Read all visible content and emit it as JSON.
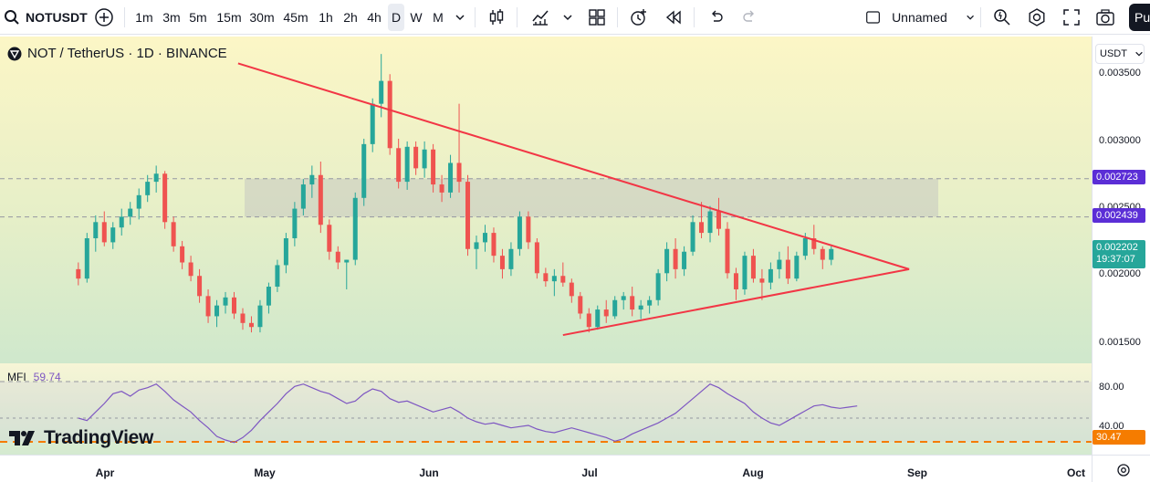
{
  "toolbar": {
    "symbol": "NOTUSDT",
    "intervals": [
      "1m",
      "3m",
      "5m",
      "15m",
      "30m",
      "45m",
      "1h",
      "2h",
      "4h",
      "D",
      "W",
      "M"
    ],
    "active_interval": "D",
    "layout_name": "Unnamed",
    "publish_label": "Pu"
  },
  "chart": {
    "title": "NOT / TetherUS · 1D · BINANCE",
    "unit": "USDT",
    "price_ticks": [
      "0.003500",
      "0.003000",
      "0.002000",
      "0.001500"
    ],
    "partial_tick": "0.002500",
    "tags": {
      "upper_zone": "0.002723",
      "lower_zone": "0.002439",
      "last_price": "0.002202",
      "countdown": "19:37:07"
    },
    "time_labels": [
      "Apr",
      "May",
      "Jun",
      "Jul",
      "Aug",
      "Sep",
      "Oct"
    ],
    "colors": {
      "up": "#26a69a",
      "down": "#ef5350",
      "trendline": "#f23645",
      "mfi_line": "#7e57c2",
      "tag_purple": "#5b2ed6",
      "tag_teal": "#26a69a",
      "tag_orange": "#f57c00"
    }
  },
  "mfi": {
    "label": "MFI",
    "value": "59.74",
    "ticks": [
      "80.00",
      "40.00"
    ],
    "level_tag": "30.47"
  },
  "logo": {
    "text": "TradingView"
  },
  "chart_data": {
    "type": "candlestick",
    "title": "NOT / TetherUS · 1D · BINANCE",
    "ylim": [
      0.00135,
      0.00378
    ],
    "zone": [
      0.002439,
      0.002723
    ],
    "trendlines": [
      {
        "from": [
          "2024-04-26",
          0.00358
        ],
        "to": [
          "2024-08-30",
          0.00205
        ]
      },
      {
        "from": [
          "2024-06-26",
          0.00156
        ],
        "to": [
          "2024-08-30",
          0.00205
        ]
      }
    ],
    "candles": [
      [
        0.00205,
        0.0021,
        0.00193,
        0.00198
      ],
      [
        0.00198,
        0.00232,
        0.00195,
        0.00228
      ],
      [
        0.00228,
        0.00245,
        0.00218,
        0.0024
      ],
      [
        0.0024,
        0.00248,
        0.00222,
        0.00225
      ],
      [
        0.00225,
        0.0024,
        0.0022,
        0.00236
      ],
      [
        0.00236,
        0.0025,
        0.0023,
        0.00244
      ],
      [
        0.00244,
        0.00255,
        0.00238,
        0.0025
      ],
      [
        0.0025,
        0.00265,
        0.00242,
        0.0026
      ],
      [
        0.0026,
        0.00275,
        0.00255,
        0.0027
      ],
      [
        0.0027,
        0.00282,
        0.00262,
        0.00276
      ],
      [
        0.00276,
        0.00278,
        0.00235,
        0.0024
      ],
      [
        0.0024,
        0.00244,
        0.00218,
        0.00222
      ],
      [
        0.00222,
        0.00226,
        0.00205,
        0.0021
      ],
      [
        0.0021,
        0.00215,
        0.00196,
        0.002
      ],
      [
        0.002,
        0.00205,
        0.0018,
        0.00185
      ],
      [
        0.00185,
        0.0019,
        0.00165,
        0.0017
      ],
      [
        0.0017,
        0.00182,
        0.00162,
        0.00178
      ],
      [
        0.00178,
        0.00188,
        0.00172,
        0.00184
      ],
      [
        0.00184,
        0.00188,
        0.00168,
        0.00172
      ],
      [
        0.00172,
        0.00176,
        0.0016,
        0.00165
      ],
      [
        0.00165,
        0.0017,
        0.00158,
        0.00162
      ],
      [
        0.00162,
        0.00182,
        0.00158,
        0.00178
      ],
      [
        0.00178,
        0.00195,
        0.00172,
        0.00192
      ],
      [
        0.00192,
        0.00212,
        0.00188,
        0.00208
      ],
      [
        0.00208,
        0.00232,
        0.00202,
        0.00228
      ],
      [
        0.00228,
        0.00255,
        0.00222,
        0.0025
      ],
      [
        0.0025,
        0.00272,
        0.00245,
        0.00268
      ],
      [
        0.00268,
        0.00282,
        0.00258,
        0.00275
      ],
      [
        0.00275,
        0.00285,
        0.00232,
        0.00238
      ],
      [
        0.00238,
        0.00242,
        0.00212,
        0.00218
      ],
      [
        0.00218,
        0.00222,
        0.00205,
        0.0021
      ],
      [
        0.0021,
        0.00212,
        0.0019,
        0.00212
      ],
      [
        0.00212,
        0.00262,
        0.00208,
        0.00258
      ],
      [
        0.00258,
        0.00302,
        0.00252,
        0.00298
      ],
      [
        0.00298,
        0.00332,
        0.00292,
        0.00328
      ],
      [
        0.00328,
        0.00365,
        0.00318,
        0.00345
      ],
      [
        0.00345,
        0.0035,
        0.0029,
        0.00295
      ],
      [
        0.00295,
        0.00302,
        0.00265,
        0.0027
      ],
      [
        0.0027,
        0.003,
        0.00264,
        0.00296
      ],
      [
        0.00296,
        0.003,
        0.00275,
        0.0028
      ],
      [
        0.0028,
        0.003,
        0.00273,
        0.00294
      ],
      [
        0.00294,
        0.00298,
        0.00262,
        0.00268
      ],
      [
        0.00268,
        0.00275,
        0.00255,
        0.00262
      ],
      [
        0.00262,
        0.0029,
        0.00258,
        0.00284
      ],
      [
        0.00284,
        0.00328,
        0.00262,
        0.0027
      ],
      [
        0.0027,
        0.00275,
        0.00215,
        0.0022
      ],
      [
        0.0022,
        0.0023,
        0.00205,
        0.00225
      ],
      [
        0.00225,
        0.00238,
        0.00218,
        0.00232
      ],
      [
        0.00232,
        0.00236,
        0.0021,
        0.00215
      ],
      [
        0.00215,
        0.0022,
        0.00198,
        0.00205
      ],
      [
        0.00205,
        0.00225,
        0.002,
        0.0022
      ],
      [
        0.0022,
        0.00248,
        0.00215,
        0.00244
      ],
      [
        0.00244,
        0.00248,
        0.0022,
        0.00225
      ],
      [
        0.00225,
        0.00228,
        0.00198,
        0.00202
      ],
      [
        0.00202,
        0.00206,
        0.00192,
        0.00196
      ],
      [
        0.00196,
        0.00205,
        0.00185,
        0.002
      ],
      [
        0.002,
        0.0021,
        0.00192,
        0.00195
      ],
      [
        0.00195,
        0.00198,
        0.0018,
        0.00185
      ],
      [
        0.00185,
        0.00188,
        0.00168,
        0.00172
      ],
      [
        0.00172,
        0.00176,
        0.00158,
        0.00162
      ],
      [
        0.00162,
        0.00178,
        0.0016,
        0.00175
      ],
      [
        0.00175,
        0.00182,
        0.00165,
        0.0017
      ],
      [
        0.0017,
        0.00185,
        0.00168,
        0.00182
      ],
      [
        0.00182,
        0.00188,
        0.00175,
        0.00185
      ],
      [
        0.00185,
        0.00192,
        0.0017,
        0.00175
      ],
      [
        0.00175,
        0.00182,
        0.00168,
        0.00178
      ],
      [
        0.00178,
        0.00185,
        0.00172,
        0.00182
      ],
      [
        0.00182,
        0.00205,
        0.00178,
        0.00202
      ],
      [
        0.00202,
        0.00225,
        0.00196,
        0.0022
      ],
      [
        0.0022,
        0.00228,
        0.00198,
        0.00205
      ],
      [
        0.00205,
        0.00222,
        0.002,
        0.00218
      ],
      [
        0.00218,
        0.00245,
        0.00215,
        0.0024
      ],
      [
        0.0024,
        0.00255,
        0.00228,
        0.00232
      ],
      [
        0.00232,
        0.00252,
        0.00225,
        0.00248
      ],
      [
        0.00248,
        0.00258,
        0.0023,
        0.00235
      ],
      [
        0.00235,
        0.0024,
        0.00198,
        0.00202
      ],
      [
        0.00202,
        0.00206,
        0.00182,
        0.0019
      ],
      [
        0.0019,
        0.00218,
        0.00186,
        0.00215
      ],
      [
        0.00215,
        0.0022,
        0.00195,
        0.00198
      ],
      [
        0.00198,
        0.00205,
        0.00182,
        0.00195
      ],
      [
        0.00195,
        0.0021,
        0.0019,
        0.00205
      ],
      [
        0.00205,
        0.00218,
        0.00198,
        0.00212
      ],
      [
        0.00212,
        0.00222,
        0.00194,
        0.00198
      ],
      [
        0.00198,
        0.00218,
        0.00196,
        0.00215
      ],
      [
        0.00215,
        0.00232,
        0.00212,
        0.00228
      ],
      [
        0.00228,
        0.00238,
        0.00216,
        0.0022
      ],
      [
        0.0022,
        0.00222,
        0.00205,
        0.00212
      ],
      [
        0.00212,
        0.00222,
        0.00208,
        0.0022
      ]
    ],
    "mfi": {
      "values": [
        50,
        48,
        55,
        62,
        70,
        72,
        68,
        73,
        75,
        78,
        72,
        65,
        60,
        55,
        48,
        42,
        35,
        32,
        30,
        34,
        40,
        48,
        55,
        62,
        70,
        76,
        78,
        75,
        72,
        70,
        66,
        62,
        64,
        70,
        74,
        72,
        66,
        63,
        64,
        61,
        58,
        55,
        57,
        59,
        55,
        50,
        47,
        45,
        46,
        44,
        42,
        43,
        44,
        41,
        39,
        38,
        40,
        42,
        40,
        38,
        36,
        34,
        31,
        33,
        37,
        40,
        43,
        46,
        50,
        54,
        60,
        66,
        72,
        78,
        75,
        70,
        66,
        62,
        55,
        50,
        46,
        44,
        48,
        52,
        56,
        60,
        61,
        59,
        58,
        59,
        60
      ],
      "ylim": [
        20,
        95
      ],
      "levels": [
        80,
        50,
        30.47
      ]
    }
  }
}
